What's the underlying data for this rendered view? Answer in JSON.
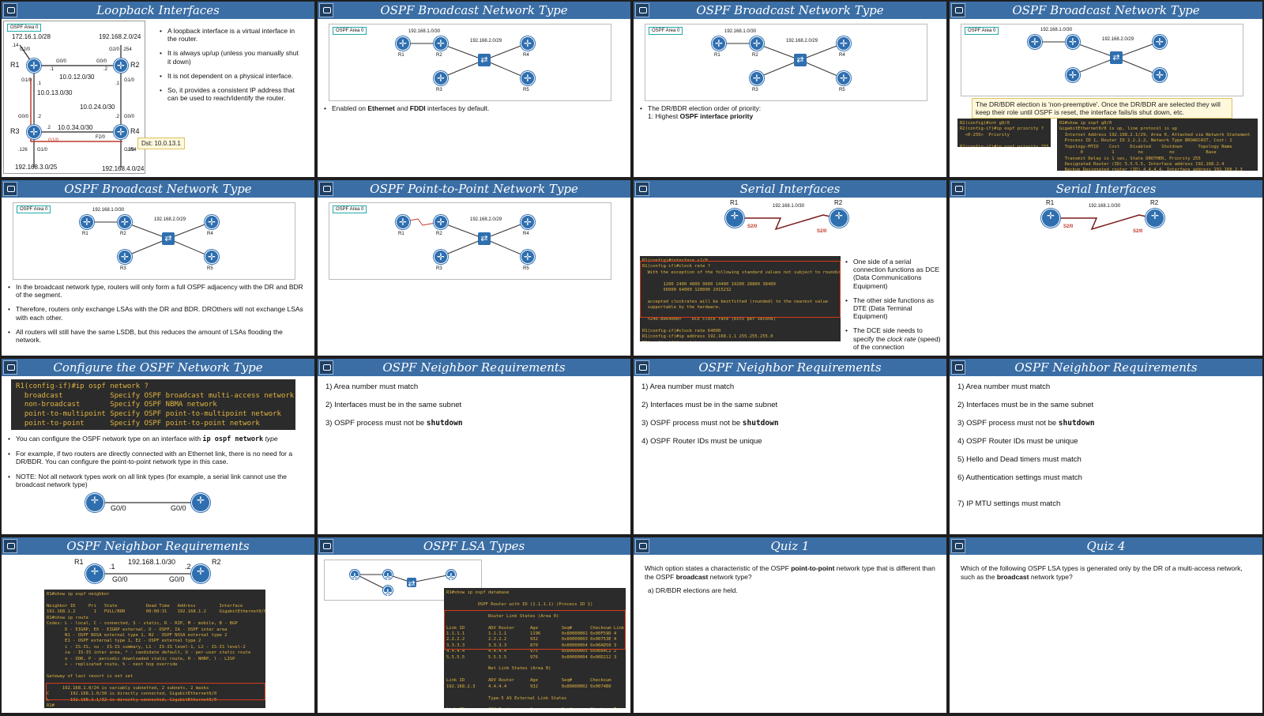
{
  "slides": {
    "s1": {
      "title": "Loopback Interfaces",
      "bullets": [
        "A loopback interface is a virtual interface in the router.",
        "It is always up/up (unless you manually shut it down)",
        "It is not dependent on a physical interface.",
        "So, it provides a consistent IP address that can be used to reach/identify the router."
      ],
      "area": "OSPF Area 0",
      "nets": {
        "n1": "172.16.1.0/28",
        "n2": "192.168.2.0/24",
        "n3": "10.0.12.0/30",
        "n4": "10.0.13.0/30",
        "n5": "10.0.24.0/30",
        "n6": "10.0.34.0/30",
        "n7": "192.168.3.0/25",
        "n8": "192.168.4.0/24"
      },
      "routers": [
        "R1",
        "R2",
        "R3",
        "R4"
      ],
      "ifs": {
        "a": ".14",
        "b": "G2/0",
        "c": "G2/0",
        "d": ".254",
        "e": "G0/0",
        "f": "G0/0",
        "g": ".1",
        "h": ".2",
        "i": "G1/0",
        "j": "G1/0",
        "k": ".1",
        "l": ".2",
        "m": "G0/0",
        "n": "G0/0",
        "o": ".2",
        "p": ".2",
        "q": ".1",
        "r": "G1/0",
        "s": "G1/0",
        "t": ".126",
        "u": ".254",
        "v": "F2/0",
        "w": "G1/0"
      },
      "tooltip": "Dst: 10.0.13.1"
    },
    "s2": {
      "title": "OSPF Broadcast Network Type",
      "area": "OSPF Area 0",
      "bullet_pre": "Enabled on ",
      "b1": "Ethernet",
      "mid": " and ",
      "b2": "FDDI",
      "bullet_post": " interfaces by default.",
      "net_top": "192.168.1.0/30",
      "net_mid": "192.168.2.0/29",
      "routers": [
        "R1",
        "R2",
        "R3",
        "R4",
        "R5"
      ]
    },
    "s3": {
      "title": "OSPF Broadcast Network Type",
      "area": "OSPF Area 0",
      "line1": "The DR/BDR election order of priority:",
      "line2_pre": "1: Highest ",
      "line2_bold": "OSPF interface priority",
      "net_top": "192.168.1.0/30",
      "net_mid": "192.168.2.0/29",
      "routers": [
        "R1",
        "R2",
        "R3",
        "R4",
        "R5"
      ]
    },
    "s4": {
      "title": "OSPF Broadcast Network Type",
      "area": "OSPF Area 0",
      "note": "The DR/BDR election is 'non-preemptive'.  Once the DR/BDR are selected they will keep their role until OSPF is reset, the interface fails/is shut down, etc.",
      "term1": "R2(config)#int g0/0\nR2(config-if)#ip ospf priority ?\n  <0-255>  Priority\n\nR2(config-if)#ip ospf priority 255",
      "term2": "R2#show ip ospf g0/0\nGigabitEthernet0/0 is up, line protocol is up\n  Internet Address 192.168.2.1/29, Area 0, Attached via Network Statement\n  Process ID 1, Router ID 2.2.2.2, Network Type BROADCAST, Cost: 1\n  Topology-MTID    Cost    Disabled    Shutdown      Topology Name\n        0           1         no          no            Base\n  Transmit Delay is 1 sec, State DROTHER, Priority 255\n  Designated Router (ID) 5.5.5.5, Interface address 192.168.2.4\n  Backup Designated router (ID) 4.4.4.4, Interface address 192.168.2.3",
      "net_top": "192.168.1.0/30",
      "net_mid": "192.168.2.0/29",
      "routers": [
        "R1",
        "R2",
        "R3",
        "R4",
        "R5"
      ]
    },
    "s5": {
      "title": "OSPF Broadcast Network Type",
      "area": "OSPF Area 0",
      "bullets": [
        "In the broadcast network type, routers will only form a full OSPF adjacency with the DR and BDR of the segment.",
        "Therefore, routers only exchange LSAs with the DR and BDR.  DROthers will not exchange LSAs with each other.",
        "All routers will still have the same LSDB, but this reduces the amount of LSAs flooding the network."
      ],
      "net_top": "192.168.1.0/30",
      "net_mid": "192.168.2.0/29",
      "routers": [
        "R1",
        "R2",
        "R3",
        "R4",
        "R5"
      ]
    },
    "s6": {
      "title": "OSPF Point-to-Point Network Type",
      "area": "OSPF Area 0",
      "net_mid": "192.168.2.0/29",
      "routers": [
        "R1",
        "R2",
        "R3",
        "R4",
        "R5"
      ]
    },
    "s7": {
      "title": "Serial Interfaces",
      "net": "192.168.1.0/30",
      "r1": "R1",
      "r2": "R2",
      "if1": "S2/0",
      "if2": "S2/0",
      "ip1": ".1",
      "ip2": ".2",
      "term": "R1(config)#interface s2/0\nR1(config-if)#clock rate ?\n  With the exception of the following standard values not subject to rounding,\n\n        1200 2400 4800 9600 14400 19200 28800 38400\n        56000 64000 128000 2015232\n\n  accepted clockrates will be bestfitted (rounded) to the nearest value\n  supportable by the hardware.\n\n  <246-8064000>    DCE clock rate (bits per second)\n\nR1(config-if)#clock rate 64000\nR1(config-if)#ip address 192.168.1.1 255.255.255.0\nR1(config-if)#no shut",
      "bullets": [
        "One side of a serial connection functions as DCE (Data Communications Equipment)",
        "The other side functions as DTE (Data Terminal Equipment)"
      ],
      "b3_pre": "The DCE side needs to specify the ",
      "b3_it": "clock rate",
      "b3_post": " (speed) of the connection"
    },
    "s8": {
      "title": "Serial Interfaces",
      "net": "192.168.1.0/30",
      "r1": "R1",
      "r2": "R2",
      "if1": "S2/0",
      "if2": "S2/0"
    },
    "s9": {
      "title": "Configure the OSPF Network Type",
      "term": "R1(config-if)#ip ospf network ?\n  broadcast           Specify OSPF broadcast multi-access network\n  non-broadcast       Specify OSPF NBMA network\n  point-to-multipoint Specify OSPF point-to-multipoint network\n  point-to-point      Specify OSPF point-to-point network",
      "b1_pre": "You can configure the OSPF network type on an interface with ",
      "b1_code": "ip ospf network",
      "b1_it": " type",
      "b2": "For example, if two routers are directly connected with an Ethernet link, there is no need for a DR/BDR.  You can configure the point-to-point network type in this case.",
      "b3": "NOTE: Not all network types work on all link types (for example, a serial link cannot use the broadcast network type)",
      "if1": "G0/0",
      "if2": "G0/0"
    },
    "s10": {
      "title": "OSPF Neighbor Requirements",
      "items": [
        "1) Area number must match",
        "2) Interfaces must be in the same subnet",
        "3) OSPF process must not be "
      ],
      "shutdown": "shutdown"
    },
    "s11": {
      "title": "OSPF Neighbor Requirements",
      "items": [
        "1) Area number must match",
        "2) Interfaces must be in the same subnet",
        "3) OSPF process must not be ",
        "4) OSPF Router IDs must be unique"
      ],
      "shutdown": "shutdown"
    },
    "s12": {
      "title": "OSPF Neighbor Requirements",
      "items": [
        "1) Area number must match",
        "2) Interfaces must be in the same subnet",
        "3) OSPF process must not be ",
        "4) OSPF Router IDs must be unique",
        "5) Hello and Dead timers must match",
        "6) Authentication settings must match",
        "7) IP MTU settings must match"
      ],
      "shutdown": "shutdown"
    },
    "s13": {
      "title": "OSPF Neighbor Requirements",
      "r1": "R1",
      "r2": "R2",
      "net": "192.168.1.0/30",
      "ip1": ".1",
      "ip2": ".2",
      "if1": "G0/0",
      "if2": "G0/0",
      "term": "R1#show ip ospf neighbor\n\nNeighbor ID     Pri   State           Dead Time   Address         Interface\n192.168.1.2       1   FULL/BDR        00:00:31    192.168.1.2     GigabitEthernet0/0\nR1#show ip route\nCodes: L - local, C - connected, S - static, R - RIP, M - mobile, B - BGP\n       D - EIGRP, EX - EIGRP external, O - OSPF, IA - OSPF inter area\n       N1 - OSPF NSSA external type 1, N2 - OSPF NSSA external type 2\n       E1 - OSPF external type 1, E2 - OSPF external type 2\n       i - IS-IS, su - IS-IS summary, L1 - IS-IS level-1, L2 - IS-IS level-2\n       ia - IS-IS inter area, * - candidate default, U - per-user static route\n       o - ODR, P - periodic downloaded static route, H - NHRP, l - LISP\n       + - replicated route, % - next hop override\n\nGateway of last resort is not set\n\n      192.168.1.0/24 is variably subnetted, 2 subnets, 2 masks\nC        192.168.1.0/30 is directly connected, GigabitEthernet0/0\nL        192.168.1.1/32 is directly connected, GigabitEthernet0/0\nR1#"
    },
    "s14": {
      "title": "OSPF LSA Types",
      "term": "R1#show ip ospf database\n\n            OSPF Router with ID (1.1.1.1) (Process ID 1)\n\n                Router Link States (Area 0)\n\nLink ID         ADV Router      Age         Seq#       Checksum Link count\n1.1.1.1         1.1.1.1         1196        0x80000002 0x00F59D 4\n2.2.2.2         2.2.2.2         932         0x80000003 0x00753E 4\n3.3.3.3         3.3.3.3         870         0x80000004 0x00AD50 3\n4.4.4.4         4.4.4.4         975         0x80000005 0x0084C2 2\n5.5.5.5         5.5.5.5         976         0x80000004 0x00D212 3\n\n                Net Link States (Area 0)\n\nLink ID         ADV Router      Age         Seq#       Checksum\n192.168.2.3     4.4.4.4         932         0x80000002 0x0074B0\n\n                Type-5 AS External Link States\n\nLink ID         ADV Router      Age         Seq#       Checksum Tag\n0.0.0.0         4.4.4.4         171         0x80000003 0x00C059 1\nR1#"
    },
    "s15": {
      "title": "Quiz 1",
      "q_pre": "Which option states a characteristic of the OSPF ",
      "q_b1": "point-to-point",
      "q_mid": " network type that is different than the OSPF ",
      "q_b2": "broadcast",
      "q_post": " network type?",
      "a": "a) DR/BDR elections are held."
    },
    "s16": {
      "title": "Quiz 4",
      "q_pre": "Which of the following OSPF LSA types is generated only by the DR of a multi-access network, such as the ",
      "q_b": "broadcast",
      "q_post": " network type?"
    }
  }
}
